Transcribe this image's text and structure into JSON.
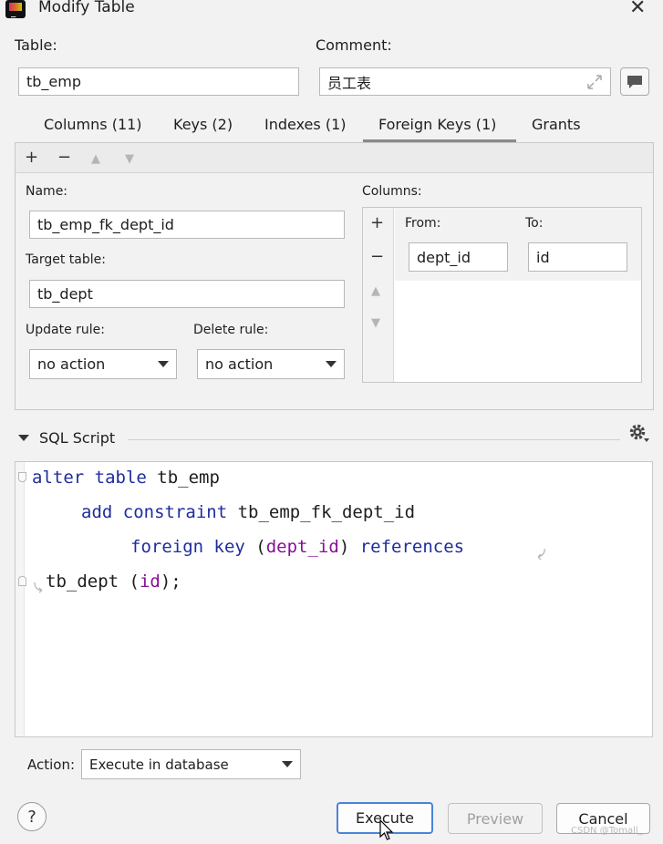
{
  "window": {
    "title": "Modify Table",
    "close": "✕"
  },
  "table": {
    "label": "Table:",
    "value": "tb_emp"
  },
  "comment": {
    "label": "Comment:",
    "value": "员工表"
  },
  "tabs": [
    {
      "label": "Columns (11)"
    },
    {
      "label": "Keys (2)"
    },
    {
      "label": "Indexes (1)"
    },
    {
      "label": "Foreign Keys (1)",
      "active": true
    },
    {
      "label": "Grants"
    }
  ],
  "toolbar": {
    "add": "+",
    "remove": "−",
    "up": "▲",
    "down": "▼"
  },
  "fk": {
    "name_label": "Name:",
    "name_value": "tb_emp_fk_dept_id",
    "target_label": "Target table:",
    "target_value": "tb_dept",
    "update_label": "Update rule:",
    "update_value": "no action",
    "delete_label": "Delete rule:",
    "delete_value": "no action",
    "columns_label": "Columns:",
    "from_label": "From:",
    "to_label": "To:",
    "from_value": "dept_id",
    "to_value": "id"
  },
  "sql": {
    "title": "SQL Script",
    "line1": {
      "kw": "alter table",
      "rest": " tb_emp"
    },
    "line2": {
      "kw": "add constraint",
      "rest": " tb_emp_fk_dept_id"
    },
    "line3": {
      "kw1": "foreign key",
      "open": " (",
      "col": "dept_id",
      "close": ") ",
      "kw2": "references"
    },
    "line4": {
      "pre": "tb_dept (",
      "col": "id",
      "post": ");"
    }
  },
  "action": {
    "label": "Action:",
    "value": "Execute in database"
  },
  "buttons": {
    "help": "?",
    "execute": "Execute",
    "preview": "Preview",
    "cancel": "Cancel"
  },
  "watermark": "CSDN @Tomall_"
}
